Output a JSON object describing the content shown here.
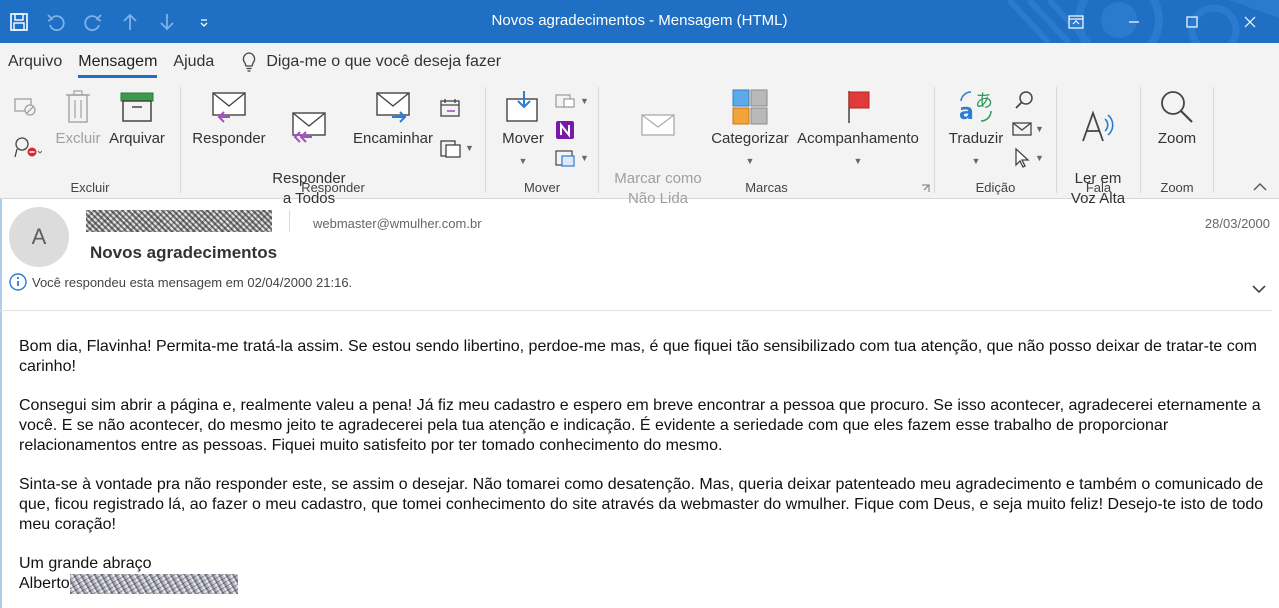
{
  "window": {
    "title": "Novos agradecimentos  -  Mensagem (HTML)"
  },
  "tabs": [
    {
      "label": "Arquivo"
    },
    {
      "label": "Mensagem"
    },
    {
      "label": "Ajuda"
    }
  ],
  "tellme": {
    "label": "Diga-me o que você deseja fazer"
  },
  "ribbon": {
    "excluir": {
      "label": "Excluir",
      "delete_label": "Excluir",
      "archive_label": "Arquivar"
    },
    "responder": {
      "label": "Responder",
      "reply_label": "Responder",
      "reply_all_label": "Responder\na Todos",
      "forward_label": "Encaminhar"
    },
    "mover": {
      "label": "Mover",
      "move_label": "Mover"
    },
    "marcas": {
      "label": "Marcas",
      "unread_label": "Marcar como\nNão Lida",
      "categorize_label": "Categorizar",
      "followup_label": "Acompanhamento"
    },
    "edicao": {
      "label": "Edição",
      "translate_label": "Traduzir"
    },
    "fala": {
      "label": "Fala",
      "read_aloud_label": "Ler em\nVoz Alta"
    },
    "zoom": {
      "label": "Zoom",
      "zoom_label": "Zoom"
    }
  },
  "message": {
    "avatar_initial": "A",
    "to_email": "webmaster@wmulher.com.br",
    "date": "28/03/2000",
    "subject": "Novos agradecimentos",
    "info": "Você respondeu esta mensagem em 02/04/2000 21:16.",
    "body": [
      "Bom dia, Flavinha! Permita-me tratá-la assim. Se estou sendo libertino, perdoe-me mas, é que fiquei tão sensibilizado com tua atenção, que não posso deixar de tratar-te com carinho!",
      "Consegui sim abrir a página e, realmente valeu a pena! Já fiz meu cadastro e espero em breve encontrar a pessoa que procuro. Se isso acontecer, agradecerei eternamente a você. E se não acontecer, do mesmo jeito te agradecerei pela tua atenção e indicação. É evidente a seriedade com que eles fazem esse trabalho de proporcionar relacionamentos entre as pessoas. Fiquei muito satisfeito por ter tomado conhecimento do mesmo.",
      "Sinta-se à vontade pra não responder este, se assim o desejar. Não tomarei como desatenção. Mas, queria deixar patenteado meu agradecimento e também o comunicado de que, ficou registrado lá, ao fazer o meu cadastro, que tomei conhecimento do site através da webmaster do wmulher. Fique com Deus, e seja muito feliz! Desejo-te isto de todo meu coração!"
    ],
    "closing": "Um grande abraço",
    "signature_first": "Alberto"
  },
  "colors": {
    "titlebar": "#1f6fc4",
    "ribbon": "#f3f3f3",
    "accent": "#1f6fc4"
  }
}
